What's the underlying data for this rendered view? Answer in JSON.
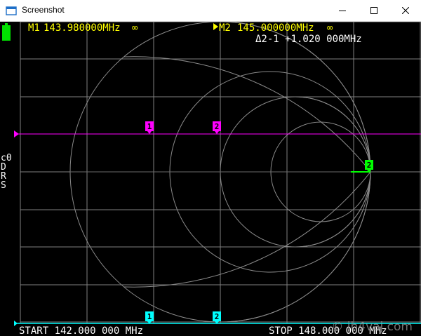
{
  "window": {
    "title": "Screenshot",
    "icons": [
      "app-icon",
      "minimize-icon",
      "maximize-icon",
      "close-icon"
    ]
  },
  "markers": {
    "m1": {
      "label": "M1",
      "value": "143.980000MHz",
      "suffix": "∞"
    },
    "m2": {
      "label": "M2",
      "value": "145.000000MHz",
      "suffix": "∞"
    },
    "delta": "Δ2-1 +1.020 000MHz",
    "tags": {
      "one": "1",
      "two": "2"
    }
  },
  "side_labels": [
    "c0",
    "D",
    "R",
    "S"
  ],
  "footer": {
    "start": "START 142.000 000 MHz",
    "stop": "STOP 148.000 000 MHz"
  },
  "watermark": "© jh4vaj.com",
  "colors": {
    "trace1": "#ffff00",
    "trace2": "#ff00ff",
    "trace3": "#00ffff",
    "trace4": "#00ff00",
    "grid": "#808080"
  }
}
